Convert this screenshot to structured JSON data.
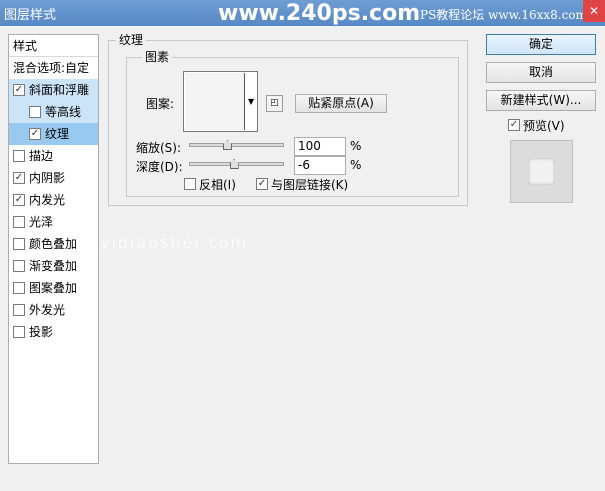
{
  "window": {
    "title": "图层样式",
    "brand": "www.240ps.com",
    "site": "PS教程论坛 www.16xx8.com",
    "close": "✕"
  },
  "watermark": "yidiaoshei.com",
  "sidebar": {
    "header": "样式",
    "blend": "混合选项:自定",
    "items": [
      {
        "label": "斜面和浮雕",
        "checked": true
      },
      {
        "label": "等高线",
        "checked": false
      },
      {
        "label": "纹理",
        "checked": true
      },
      {
        "label": "描边",
        "checked": false
      },
      {
        "label": "内阴影",
        "checked": true
      },
      {
        "label": "内发光",
        "checked": true
      },
      {
        "label": "光泽",
        "checked": false
      },
      {
        "label": "颜色叠加",
        "checked": false
      },
      {
        "label": "渐变叠加",
        "checked": false
      },
      {
        "label": "图案叠加",
        "checked": false
      },
      {
        "label": "外发光",
        "checked": false
      },
      {
        "label": "投影",
        "checked": false
      }
    ]
  },
  "texture": {
    "section_title": "纹理",
    "group_title": "图素",
    "pattern_label": "图案:",
    "snap_button": "贴紧原点(A)",
    "scale_label": "缩放(S):",
    "scale_value": "100",
    "scale_level": 0.4,
    "depth_label": "深度(D):",
    "depth_value": "-6",
    "depth_level": 0.47,
    "unit": "%",
    "invert_label": "反相(I)",
    "invert_checked": false,
    "link_label": "与图层链接(K)",
    "link_checked": true
  },
  "buttons": {
    "ok": "确定",
    "cancel": "取消",
    "new_style": "新建样式(W)...",
    "preview_label": "预览(V)",
    "preview_checked": true
  }
}
